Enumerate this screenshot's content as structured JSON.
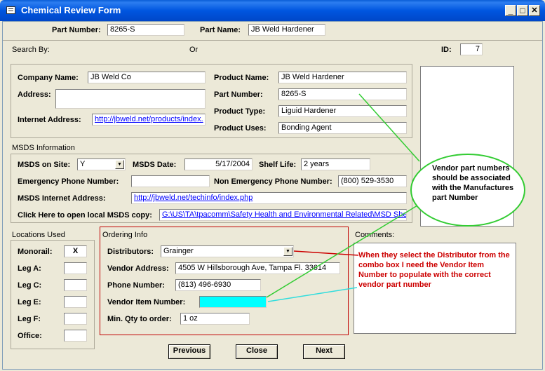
{
  "window": {
    "title": "Chemical Review Form",
    "buttons": {
      "minimize": "_",
      "maximize": "□",
      "close": "✕"
    }
  },
  "header": {
    "part_number_label": "Part Number:",
    "part_number_value": "8265-S",
    "part_name_label": "Part Name:",
    "part_name_value": "JB Weld Hardener"
  },
  "search": {
    "label": "Search By:",
    "or": "Or",
    "id_label": "ID:",
    "id_value": "7"
  },
  "company": {
    "company_name_label": "Company Name:",
    "company_name_value": "JB Weld Co",
    "address_label": "Address:",
    "address_value": "",
    "internet_label": "Internet Address:",
    "internet_value": "http://jbweld.net/products/index.",
    "product_name_label": "Product Name:",
    "product_name_value": "JB Weld Hardener",
    "part_number_label": "Part Number:",
    "part_number_value": "8265-S",
    "product_type_label": "Product Type:",
    "product_type_value": "Liguid Hardener",
    "product_uses_label": "Product Uses:",
    "product_uses_value": "Bonding Agent"
  },
  "msds": {
    "section_label": "MSDS Information",
    "on_site_label": "MSDS on Site:",
    "on_site_value": "Y",
    "date_label": "MSDS Date:",
    "date_value": "5/17/2004",
    "shelf_life_label": "Shelf Life:",
    "shelf_life_value": "2 years",
    "emergency_label": "Emergency Phone Number:",
    "emergency_value": "",
    "non_emergency_label": "Non Emergency Phone Number:",
    "non_emergency_value": "(800) 529-3530",
    "internet_label": "MSDS Internet Address:",
    "internet_value": "http://jbweld.net/techinfo/index.php",
    "local_label": "Click Here to open local MSDS copy:",
    "local_value": "G:\\US\\TA\\tpacomm\\Safety Health and Environmental Related\\MSD Shee"
  },
  "locations": {
    "section_label": "Locations Used",
    "items": [
      {
        "label": "Monorail:",
        "value": "X"
      },
      {
        "label": "Leg A:",
        "value": ""
      },
      {
        "label": "Leg C:",
        "value": ""
      },
      {
        "label": "Leg E:",
        "value": ""
      },
      {
        "label": "Leg F:",
        "value": ""
      },
      {
        "label": "Office:",
        "value": ""
      }
    ]
  },
  "ordering": {
    "section_label": "Ordering Info",
    "distributors_label": "Distributors:",
    "distributors_value": "Grainger",
    "vendor_address_label": "Vendor Address:",
    "vendor_address_value": "4505 W Hillsborough Ave, Tampa Fl. 33614",
    "phone_label": "Phone Number:",
    "phone_value": "(813) 496-6930",
    "vendor_item_label": "Vendor Item Number:",
    "vendor_item_value": "",
    "min_qty_label": "Min. Qty to order:",
    "min_qty_value": "1 oz"
  },
  "comments": {
    "label": "Comments:"
  },
  "annotations": {
    "red_note": "When they select the Distributor from the combo box I need the Vendor Item Number to populate with the correct vendor part number",
    "green_note": "Vendor part numbers should be associated with the Manufactures part Number"
  },
  "nav": {
    "previous": "Previous",
    "close": "Close",
    "next": "Next"
  },
  "colors": {
    "titlebar": "#0054e3",
    "vendor_item_fill": "#00ffff",
    "annotation_red": "#cc0000",
    "ellipse_green": "#33cc33"
  }
}
